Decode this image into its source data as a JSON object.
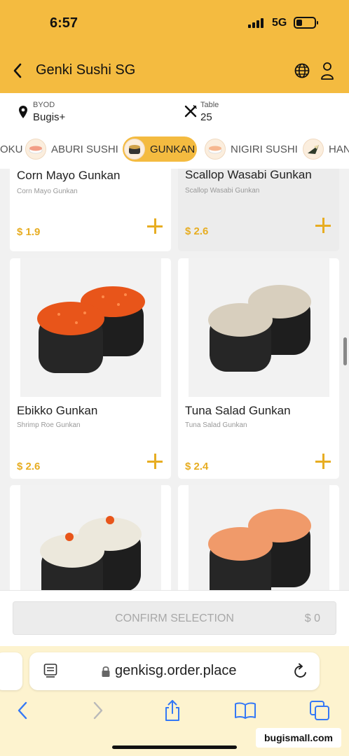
{
  "status_bar": {
    "time": "6:57",
    "network": "5G",
    "battery_level": 0.35
  },
  "header": {
    "title": "Genki Sushi SG",
    "bg_color": "#f4bb40"
  },
  "info": {
    "location_label": "BYOD",
    "location_value": "Bugis+",
    "table_label": "Table",
    "table_value": "25"
  },
  "categories": [
    {
      "label": "OKU",
      "active": false
    },
    {
      "label": "ABURI SUSHI",
      "active": false
    },
    {
      "label": "GUNKAN",
      "active": true
    },
    {
      "label": "NIGIRI SUSHI",
      "active": false
    },
    {
      "label": "HAN",
      "active": false
    }
  ],
  "products": [
    {
      "name": "Corn Mayo Gunkan",
      "subtitle": "Corn Mayo Gunkan",
      "price": "$ 1.9"
    },
    {
      "name": "Scallop Wasabi Gunkan",
      "subtitle": "Scallop Wasabi Gunkan",
      "price": "$ 2.6"
    },
    {
      "name": "Ebikko Gunkan",
      "subtitle": "Shrimp Roe Gunkan",
      "price": "$ 2.6",
      "topping_color": "#e8551a"
    },
    {
      "name": "Tuna Salad Gunkan",
      "subtitle": "Tuna Salad Gunkan",
      "price": "$ 2.4",
      "topping_color": "#d8cfbe"
    },
    {
      "name": "",
      "subtitle": "",
      "price": "",
      "topping_color": "#ece8dc"
    },
    {
      "name": "",
      "subtitle": "",
      "price": "",
      "topping_color": "#f09a6a"
    }
  ],
  "confirm": {
    "label": "CONFIRM SELECTION",
    "amount": "$ 0"
  },
  "browser": {
    "url": "genkisg.order.place"
  },
  "watermark": "bugismall.com",
  "accent_color": "#e7ad22"
}
